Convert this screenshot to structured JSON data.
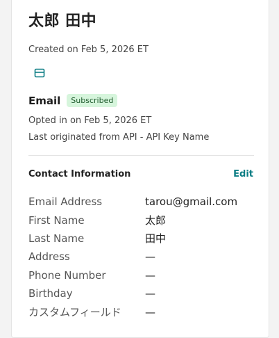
{
  "contact": {
    "name": "太郎 田中",
    "created": "Created on Feb 5, 2026 ET"
  },
  "email_channel": {
    "icon": "email-icon",
    "title": "Email",
    "status_badge": "Subscribed",
    "opted_in": "Opted in on Feb 5, 2026 ET",
    "origin": "Last originated from API - API Key Name"
  },
  "contact_info": {
    "title": "Contact Information",
    "edit_label": "Edit",
    "rows": [
      {
        "label": "Email Address",
        "value": "tarou@gmail.com"
      },
      {
        "label": "First Name",
        "value": "太郎"
      },
      {
        "label": "Last Name",
        "value": "田中"
      },
      {
        "label": "Address",
        "value": "—"
      },
      {
        "label": "Phone Number",
        "value": "—"
      },
      {
        "label": "Birthday",
        "value": "—"
      },
      {
        "label": "カスタムフィールド",
        "value": "—"
      }
    ]
  },
  "colors": {
    "accent": "#0b7d84",
    "badge_bg": "#d6f5dc",
    "badge_text": "#1f5a2d"
  }
}
